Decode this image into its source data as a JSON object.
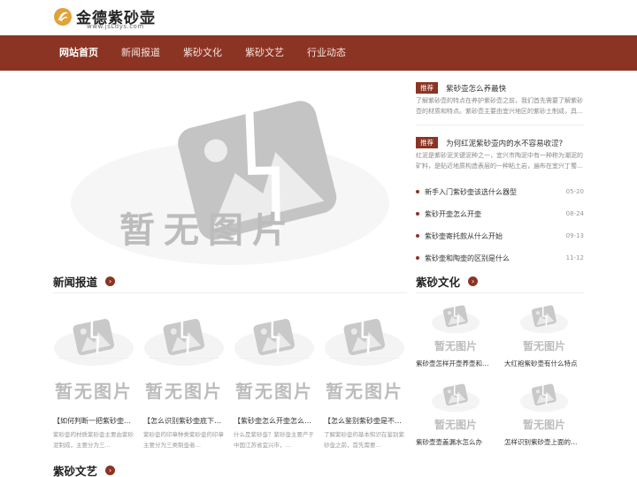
{
  "site": {
    "name": "金德紫砂壶",
    "domain": "www.jsLdys.com"
  },
  "colors": {
    "brand": "#8c3424",
    "badge": "#8c3424"
  },
  "nav": {
    "items": [
      {
        "label": "网站首页",
        "active": true
      },
      {
        "label": "新闻报道"
      },
      {
        "label": "紫砂文化"
      },
      {
        "label": "紫砂文艺"
      },
      {
        "label": "行业动态"
      }
    ]
  },
  "hero": {
    "placeholder_text": "暂无图片"
  },
  "recommend": [
    {
      "badge": "推荐",
      "title": "紫砂壶怎么养最快",
      "desc": "了解紫砂壶的特点在养护紫砂壶之前，我们首先需要了解紫砂壶的材质和特点。紫砂壶主要由宜兴地区的紫砂土制成，具…"
    },
    {
      "badge": "推荐",
      "title": "为何红泥紫砂壶内的水不容易收涩?",
      "desc": "红泥是紫砂泥关键泥种之一，宜兴市陶泥中有一种称为潮泥的矿料，是贴近地质构造表层的一种粘土岩，遍布在宜兴丁蜀…"
    }
  ],
  "news_list": [
    {
      "title": "新手入门紫砂壶该选什么器型",
      "date": "05-20"
    },
    {
      "title": "紫砂开壶怎么开壶",
      "date": "08-24"
    },
    {
      "title": "紫砂壶寄托款从什么开始",
      "date": "09-13"
    },
    {
      "title": "紫砂壶和陶壶的区别是什么",
      "date": "11-12"
    }
  ],
  "sections": {
    "news": {
      "title": "新闻报道"
    },
    "culture": {
      "title": "紫砂文化"
    },
    "arts": {
      "title": "紫砂文艺"
    }
  },
  "news_cards": [
    {
      "title": "【如何判断一把紫砂壶…",
      "desc": "紫砂壶的材质紫砂壶主要由紫砂泥制成，主要分为三…"
    },
    {
      "title": "【怎么识别紫砂壶底下…",
      "desc": "紫砂壶的印章种类紫砂壶的印章主要分为三类制壶者…"
    },
    {
      "title": "【紫砂壶怎么开壶怎么…",
      "desc": "什么是紫砂壶？紫砂壶主要产于中国江苏省宜兴市，…"
    },
    {
      "title": "【怎么鉴别紫砂壶是不…",
      "desc": "了解紫砂壶的基本知识在鉴别紫砂壶之前，首先需要…"
    }
  ],
  "culture_thumbs": [
    {
      "title": "紫砂壶怎样开壶养壶和…"
    },
    {
      "title": "大红袍紫砂壶有什么特点"
    },
    {
      "title": "紫砂壶壶盖漏水怎么办"
    },
    {
      "title": "怎样识别紫砂壶上面的…"
    }
  ]
}
